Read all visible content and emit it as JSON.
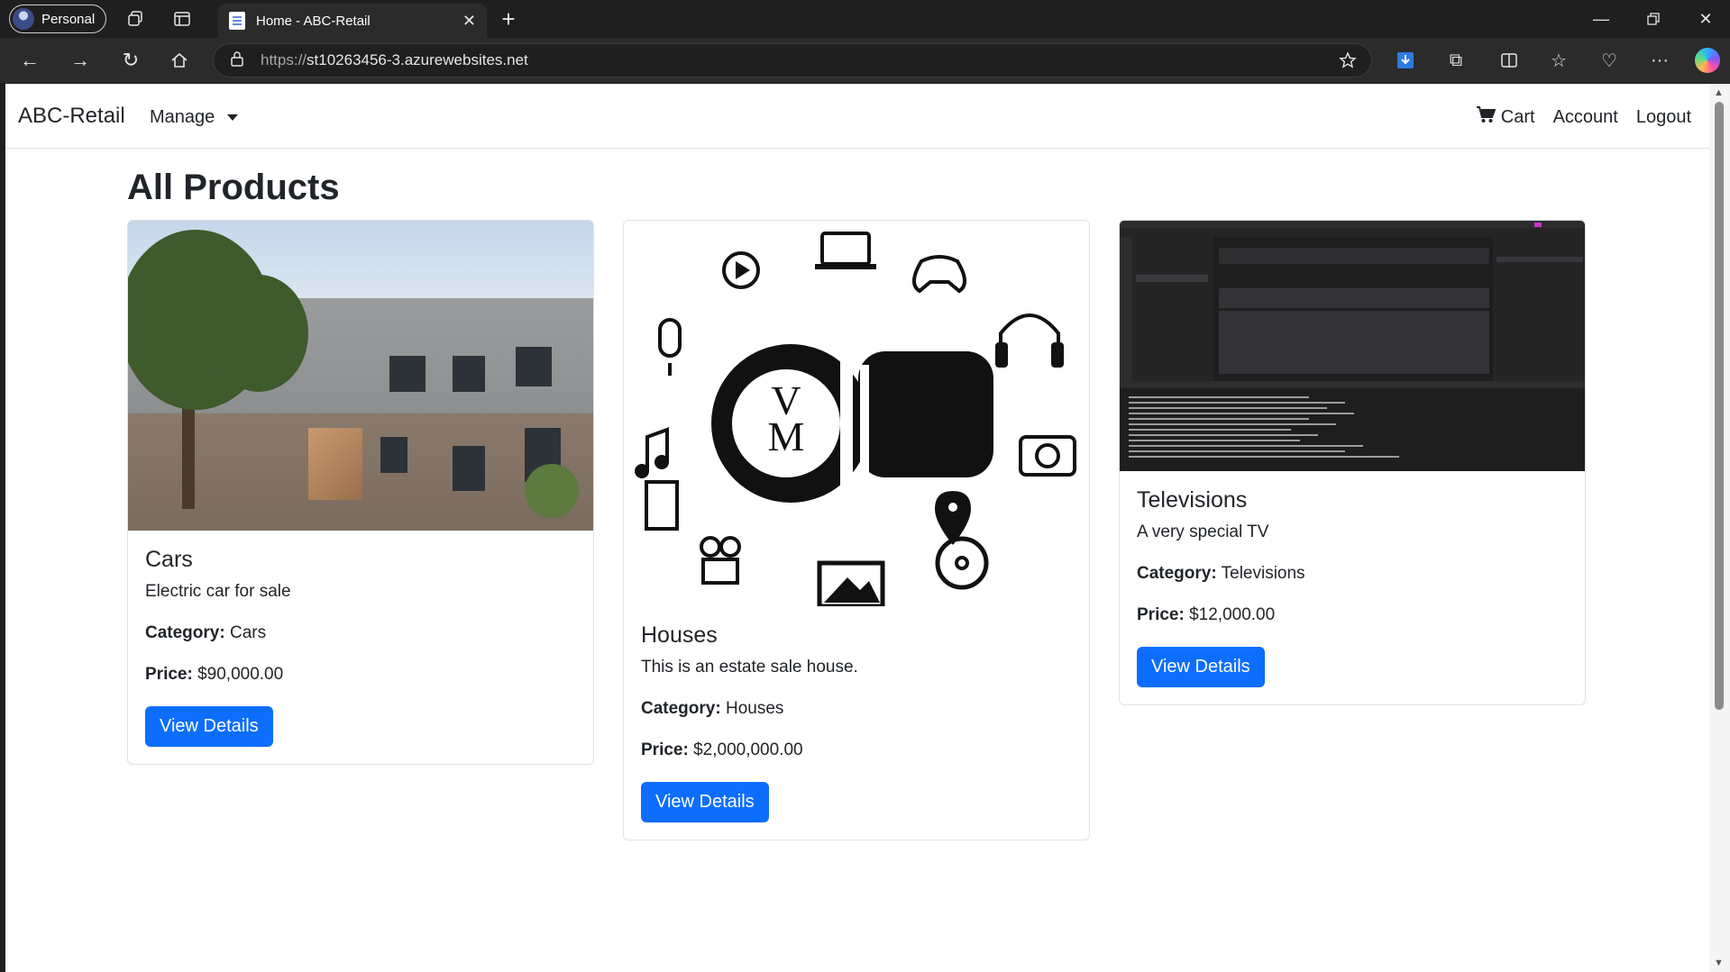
{
  "browser": {
    "profile_label": "Personal",
    "tab_title": "Home - ABC-Retail",
    "url_protocol": "https://",
    "url_host": "st10263456-3.azurewebsites.net"
  },
  "navbar": {
    "brand": "ABC-Retail",
    "manage_label": "Manage",
    "cart_label": "Cart",
    "account_label": "Account",
    "logout_label": "Logout"
  },
  "page": {
    "heading": "All Products"
  },
  "products": [
    {
      "name": "Cars",
      "description": "Electric car for sale",
      "category_label": "Category:",
      "category": "Cars",
      "price_label": "Price:",
      "price": "$90,000.00",
      "button_label": "View Details"
    },
    {
      "name": "Houses",
      "description": "This is an estate sale house.",
      "category_label": "Category:",
      "category": "Houses",
      "price_label": "Price:",
      "price": "$2,000,000.00",
      "button_label": "View Details"
    },
    {
      "name": "Televisions",
      "description": "A very special TV",
      "category_label": "Category:",
      "category": "Televisions",
      "price_label": "Price:",
      "price": "$12,000.00",
      "button_label": "View Details"
    }
  ],
  "colors": {
    "primary_button": "#0d6efd",
    "chrome_dark": "#1f1f1f",
    "text": "#212529"
  }
}
